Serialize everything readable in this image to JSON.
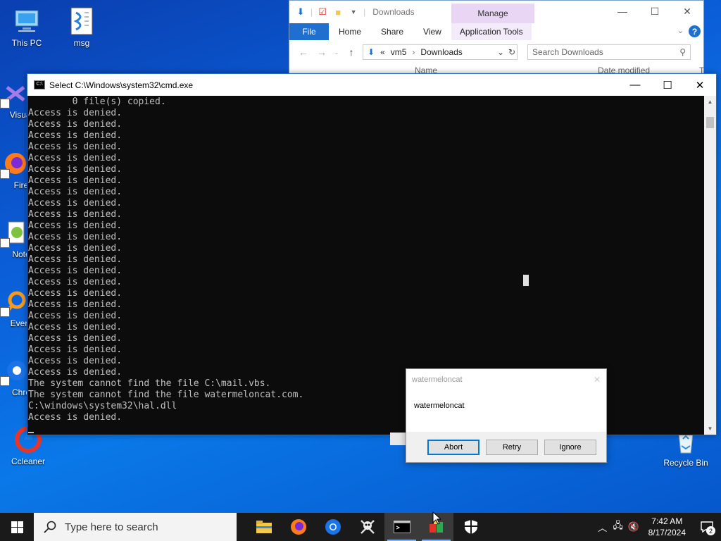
{
  "desktop": {
    "icons": [
      {
        "label": "This PC"
      },
      {
        "label": "msg"
      },
      {
        "label": "Visual"
      },
      {
        "label": "Fire"
      },
      {
        "label": "Note"
      },
      {
        "label": "Every"
      },
      {
        "label": "Chro"
      },
      {
        "label": "Ccleaner"
      },
      {
        "label": "Recycle Bin"
      }
    ]
  },
  "explorer": {
    "title": "Downloads",
    "manage_tab": "Manage",
    "tabs": [
      "File",
      "Home",
      "Share",
      "View",
      "Application Tools"
    ],
    "breadcrumb_prefix": "«",
    "breadcrumb": [
      "vm5",
      "Downloads"
    ],
    "search_placeholder": "Search Downloads",
    "columns": [
      "Name",
      "Date modified",
      "T"
    ]
  },
  "cmd": {
    "title": "Select C:\\Windows\\system32\\cmd.exe",
    "lines": [
      "        0 file(s) copied.",
      "Access is denied.",
      "Access is denied.",
      "Access is denied.",
      "Access is denied.",
      "Access is denied.",
      "Access is denied.",
      "Access is denied.",
      "Access is denied.",
      "Access is denied.",
      "Access is denied.",
      "Access is denied.",
      "Access is denied.",
      "Access is denied.",
      "Access is denied.",
      "Access is denied.",
      "Access is denied.",
      "Access is denied.",
      "Access is denied.",
      "Access is denied.",
      "Access is denied.",
      "Access is denied.",
      "Access is denied.",
      "Access is denied.",
      "Access is denied.",
      "The system cannot find the file C:\\mail.vbs.",
      "The system cannot find the file watermeloncat.com.",
      "C:\\windows\\system32\\hal.dll",
      "Access is denied."
    ]
  },
  "msgbox": {
    "title": "watermeloncat",
    "text": "watermeloncat",
    "buttons": {
      "abort": "Abort",
      "retry": "Retry",
      "ignore": "Ignore"
    }
  },
  "taskbar": {
    "search_placeholder": "Type here to search",
    "time": "7:42 AM",
    "date": "8/17/2024",
    "notification_count": "2"
  }
}
